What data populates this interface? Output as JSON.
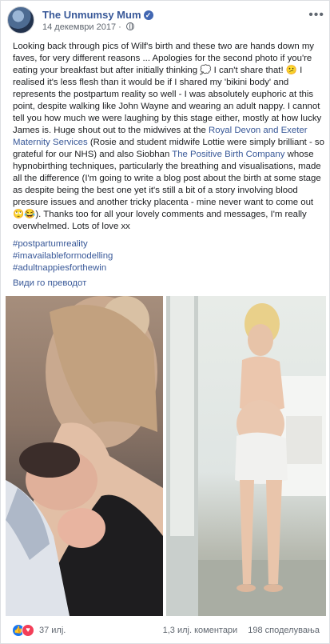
{
  "post": {
    "author": "The Unmumsy Mum",
    "date": "14 декември 2017",
    "date_separator": "·",
    "body_part1": "Looking back through pics of Wilf's birth and these two are hands down my faves, for very different reasons ... Apologies for the second photo if you're eating your breakfast but after initially thinking 💭 I can't share that! 😕 I realised it's less flesh than it would be if I shared my 'bikini body' and represents the postpartum reality so well - I was absolutely euphoric at this point, despite walking like John Wayne and wearing an adult nappy. I cannot tell you how much we were laughing by this stage either, mostly at how lucky James is. Huge shout out to the midwives at the ",
    "link1": "Royal Devon and Exeter Maternity Services",
    "body_part2": " (Rosie and student midwife Lottie were simply brilliant - so grateful for our NHS) and also Siobhan ",
    "link2": "The Positive Birth Company",
    "body_part3": " whose hypnobirthing techniques, particularly the breathing and visualisations, made all the difference (I'm going to write a blog post about the birth at some stage as despite being the best one yet it's still a bit of a story involving blood pressure issues and another tricky placenta - mine never want to come out 🙄😂). Thanks too for all your lovely comments and messages, I'm really overwhelmed. Lots of love xx",
    "hashtags": [
      "#postpartumreality",
      "#imavailableformodelling",
      "#adultnappiesforthewin"
    ],
    "translate_label": "Види го преводот"
  },
  "footer": {
    "likes": "37 илј.",
    "comments": "1,3 илј. коментари",
    "shares": "198 споделувања"
  },
  "colors": {
    "link": "#385898",
    "like": "#1877f2",
    "love": "#f33e58"
  }
}
